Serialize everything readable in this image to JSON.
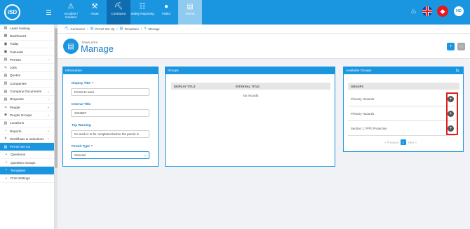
{
  "topbar": {
    "logo": "iSD",
    "nav": [
      {
        "label": "Accident / Incident",
        "icon": "accident-icon",
        "state": "normal"
      },
      {
        "label": "Asset",
        "icon": "asset-icon",
        "state": "normal"
      },
      {
        "label": "Contractor",
        "icon": "contractor-icon",
        "state": "active"
      },
      {
        "label": "Safety Reporting",
        "icon": "safety-reporting-icon",
        "state": "normal"
      },
      {
        "label": "Visitor",
        "icon": "visitor-icon",
        "state": "normal"
      },
      {
        "label": "Permit",
        "icon": "permit-icon",
        "state": "selected"
      }
    ],
    "avatar": "HD"
  },
  "sidebar": {
    "items": [
      {
        "label": "Learn training",
        "icon": "book-icon",
        "chevron": false,
        "active": false,
        "sub": false
      },
      {
        "label": "Dashboard",
        "icon": "dashboard-icon",
        "chevron": false,
        "active": false,
        "sub": false
      },
      {
        "label": "Today",
        "icon": "calendar-icon",
        "chevron": false,
        "active": false,
        "sub": false
      },
      {
        "label": "Calendar",
        "icon": "calendar-icon",
        "chevron": false,
        "active": false,
        "sub": false
      },
      {
        "label": "Permits",
        "icon": "permits-icon",
        "chevron": true,
        "active": false,
        "sub": false
      },
      {
        "label": "Jobs",
        "icon": "jobs-icon",
        "chevron": false,
        "active": false,
        "sub": false
      },
      {
        "label": "Quotes",
        "icon": "quotes-icon",
        "chevron": false,
        "active": false,
        "sub": false
      },
      {
        "label": "Companies",
        "icon": "companies-icon",
        "chevron": false,
        "active": false,
        "sub": false
      },
      {
        "label": "Company Documents",
        "icon": "documents-icon",
        "chevron": true,
        "active": false,
        "sub": false
      },
      {
        "label": "Requests",
        "icon": "requests-icon",
        "chevron": true,
        "active": false,
        "sub": false
      },
      {
        "label": "People",
        "icon": "people-icon",
        "chevron": true,
        "active": false,
        "sub": false
      },
      {
        "label": "People Groups",
        "icon": "people-groups-icon",
        "chevron": true,
        "active": false,
        "sub": false
      },
      {
        "label": "Locations",
        "icon": "locations-icon",
        "chevron": false,
        "active": false,
        "sub": false
      },
      {
        "label": "Reports",
        "icon": "reports-icon",
        "chevron": true,
        "active": false,
        "sub": false
      },
      {
        "label": "Workflows & Inductions",
        "icon": "workflows-icon",
        "chevron": true,
        "active": false,
        "sub": false
      },
      {
        "label": "Permit Set Up",
        "icon": "permit-setup-icon",
        "chevron": false,
        "active": true,
        "sub": false
      },
      {
        "label": "Questions",
        "icon": "bullet-icon",
        "chevron": false,
        "active": false,
        "sub": true
      },
      {
        "label": "Question Groups",
        "icon": "bullet-icon",
        "chevron": false,
        "active": false,
        "sub": true
      },
      {
        "label": "Templates",
        "icon": "bullet-icon",
        "chevron": false,
        "active": true,
        "sub": true
      },
      {
        "label": "Print Settings",
        "icon": "bullet-icon",
        "chevron": false,
        "active": false,
        "sub": true
      }
    ]
  },
  "breadcrumb": [
    {
      "label": "Contractor",
      "icon": "contractor-icon"
    },
    {
      "label": "Permit Set Up",
      "icon": "permit-setup-icon"
    },
    {
      "label": "Templates",
      "icon": "templates-icon"
    },
    {
      "label": "Manage",
      "icon": "pencil-icon"
    }
  ],
  "header": {
    "subtitle": "TEMPLATES",
    "title": "Manage"
  },
  "information": {
    "title": "Information",
    "display_title_label": "Display Title",
    "display_title_value": "Permit to work",
    "internal_title_label": "Internal Title",
    "internal_title_value": "1234567",
    "top_warning_label": "Top Warning",
    "top_warning_value": "No work is to be completed before the permit is",
    "permit_type_label": "Permit Type",
    "permit_type_value": "General",
    "required_mark": "*"
  },
  "groups": {
    "title": "Groups",
    "columns": [
      "DISPLAY TITLE",
      "INTERNAL TITLE"
    ],
    "empty": "No records"
  },
  "available_groups": {
    "title": "Available Groups",
    "column": "GROUPS",
    "rows": [
      "Primary Hazards",
      "Primary Hazards",
      "Section 1: PPE Protection"
    ],
    "pager": {
      "previous": "Previous",
      "page": "1",
      "next": "Next"
    }
  },
  "colors": {
    "primary": "#1a96e0",
    "highlight": "#e0201e"
  }
}
